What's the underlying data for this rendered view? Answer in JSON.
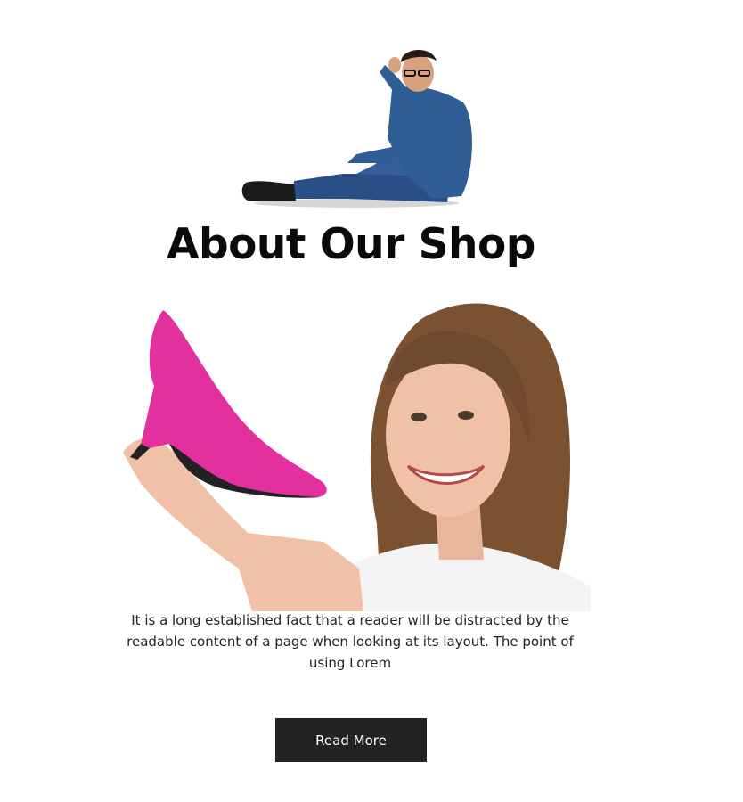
{
  "about": {
    "title": "About Our Shop",
    "description": "It is a long established fact that a reader will be distracted by the readable content of a page when looking at its layout. The point of using Lorem",
    "button_label": "Read More"
  },
  "colors": {
    "button_bg": "#232323",
    "button_text": "#ffffff",
    "title_text": "#0a0a0a",
    "body_text": "#222222",
    "shoe_pink": "#e2319f",
    "denim_blue": "#2f5d95",
    "hair_brown": "#7a5232"
  }
}
